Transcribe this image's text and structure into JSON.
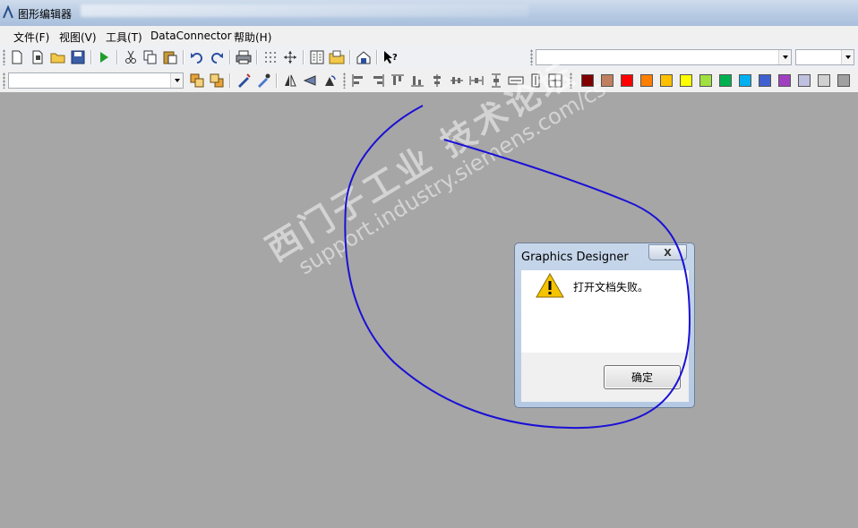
{
  "window": {
    "title": "图形编辑器"
  },
  "menu": {
    "items": [
      {
        "label": "文件(F)"
      },
      {
        "label": "视图(V)"
      },
      {
        "label": "工具(T)"
      },
      {
        "label": "DataConnector"
      },
      {
        "label": "帮助(H)"
      }
    ]
  },
  "toolbar": {
    "font_combo_value": "",
    "size_combo_value": "",
    "object_combo_value": ""
  },
  "palette": {
    "colors": [
      "#800000",
      "#c08060",
      "#ff0000",
      "#ff8000",
      "#ffc000",
      "#ffff00",
      "#a0e040",
      "#00b050",
      "#00b0f0",
      "#4060d0",
      "#a040c0",
      "#c0c0e0",
      "#d0d0d0",
      "#a0a0a0"
    ]
  },
  "watermark": {
    "line1": "西门子工业 技术论坛",
    "line2": "support.industry.siemens.com/cs"
  },
  "dialog": {
    "title": "Graphics Designer",
    "close_label": "X",
    "message": "打开文档失败。",
    "ok_label": "确定"
  },
  "annotation": {
    "color": "#1a10d6"
  }
}
